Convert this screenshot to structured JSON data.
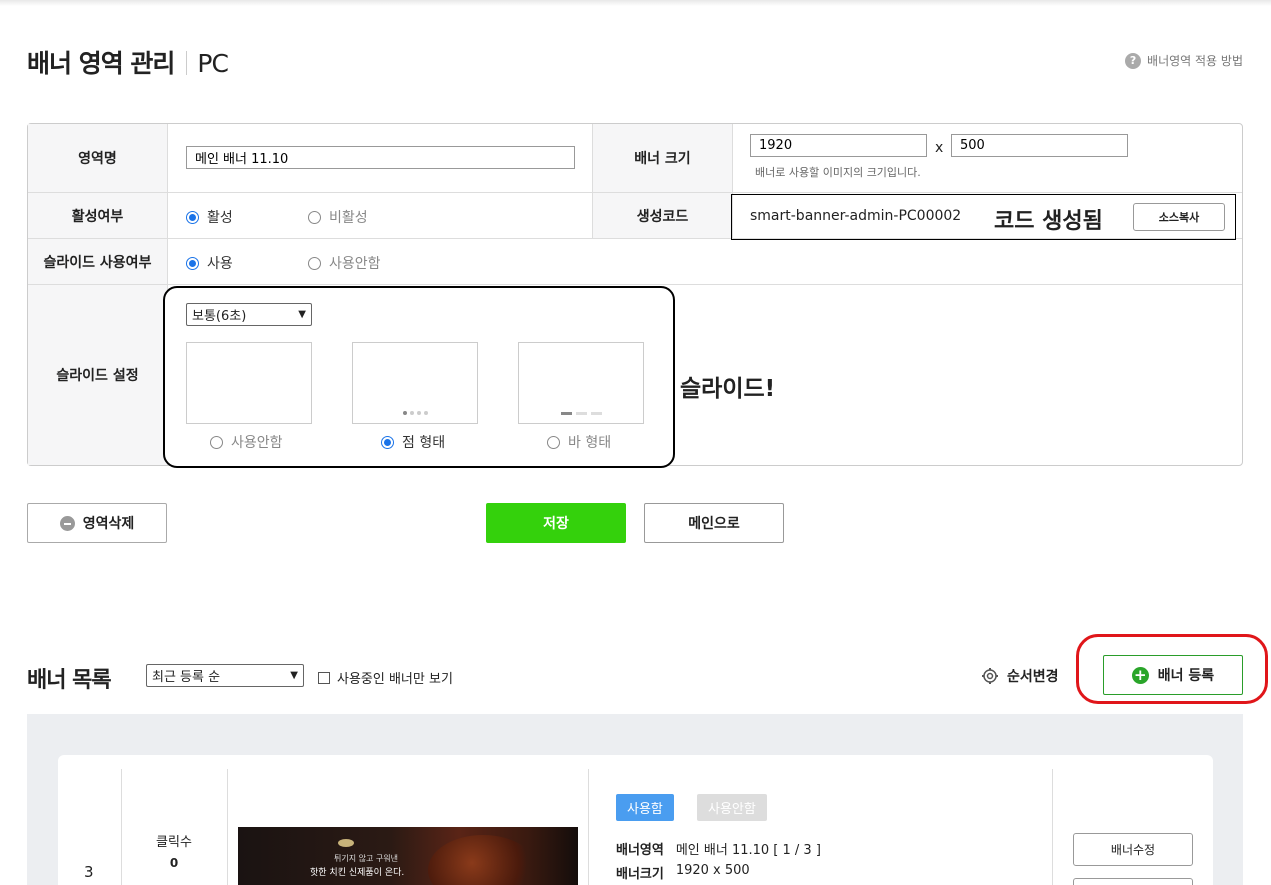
{
  "header": {
    "title": "배너 영역 관리",
    "subtitle": "PC",
    "help_label": "배너영역 적용 방법",
    "help_icon": "question-icon"
  },
  "form": {
    "area_name": {
      "label": "영역명",
      "value": "메인 배너 11.10"
    },
    "banner_size": {
      "label": "배너 크기",
      "width": "1920",
      "times": "x",
      "height": "500",
      "hint": "배너로 사용할 이미지의 크기입니다."
    },
    "active": {
      "label": "활성여부",
      "options": [
        "활성",
        "비활성"
      ],
      "selected": "활성"
    },
    "code": {
      "label": "생성코드",
      "value": "smart-banner-admin-PC00002",
      "note": "코드 생성됨",
      "copy_button": "소스복사"
    },
    "slide_use": {
      "label": "슬라이드 사용여부",
      "options": [
        "사용",
        "사용안함"
      ],
      "selected": "사용"
    },
    "slide_setting": {
      "label": "슬라이드 설정",
      "speed": "보통(6초)",
      "styles": [
        "사용안함",
        "점 형태",
        "바 형태"
      ],
      "selected": "점 형태",
      "note": "슬라이드!"
    }
  },
  "actions": {
    "delete": "영역삭제",
    "save": "저장",
    "main": "메인으로"
  },
  "list": {
    "title": "배너 목록",
    "sort": "최근 등록 순",
    "filter_label": "사용중인 배너만 보기",
    "order_label": "순서변경",
    "register_label": "배너 등록",
    "item": {
      "number": "3",
      "clicks_label": "클릭수",
      "clicks_value": "0",
      "banner_text_1": "튀기지 않고 구워낸",
      "banner_text_2": "핫한 치킨 신제품이 온다.",
      "status_on": "사용함",
      "status_off": "사용안함",
      "area_label": "배너영역",
      "area_value": "메인 배너 11.10  [ 1 / 3 ]",
      "size_label": "배너크기",
      "size_value": "1920 x 500",
      "edit_button": "배너수정"
    }
  },
  "colors": {
    "save_green": "#34d10c",
    "accent_blue": "#4a9df0",
    "radio_blue": "#1a73e8",
    "highlight_red": "#e0161a"
  }
}
